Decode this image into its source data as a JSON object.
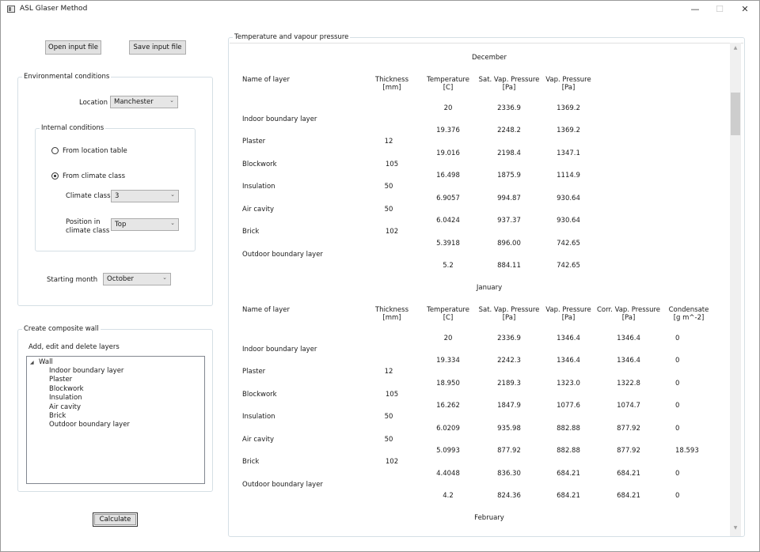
{
  "window": {
    "title": "ASL Glaser Method",
    "min": "—",
    "max": "☐",
    "close": "✕"
  },
  "buttons": {
    "open": "Open input file",
    "save": "Save input file",
    "calculate": "Calculate"
  },
  "env": {
    "title": "Environmental conditions",
    "location_label": "Location",
    "location_value": "Manchester",
    "internal": {
      "title": "Internal conditions",
      "radio_location": "From location table",
      "radio_climate": "From climate class",
      "climate_class_label": "Climate class",
      "climate_class_value": "3",
      "position_label_1": "Position in",
      "position_label_2": "climate class",
      "position_value": "Top"
    },
    "starting_month_label": "Starting month",
    "starting_month_value": "October"
  },
  "wall": {
    "title": "Create composite wall",
    "subtitle": "Add, edit and delete layers",
    "root": "Wall",
    "layers": [
      "Indoor boundary layer",
      "Plaster",
      "Blockwork",
      "Insulation",
      "Air cavity",
      "Brick",
      "Outdoor boundary layer"
    ]
  },
  "results": {
    "title": "Temperature and vapour pressure",
    "headers": {
      "name": "Name of layer",
      "thick1": "Thickness",
      "thick2": "[mm]",
      "temp1": "Temperature",
      "temp2": "[C]",
      "sat1": "Sat. Vap. Pressure",
      "sat2": "[Pa]",
      "vap1": "Vap. Pressure",
      "vap2": "[Pa]",
      "corr1": "Corr. Vap. Pressure",
      "corr2": "[Pa]",
      "cond1": "Condensate",
      "cond2": "[g m^-2]"
    },
    "december": {
      "month": "December",
      "layers": [
        {
          "name": "Indoor boundary layer",
          "thickness": ""
        },
        {
          "name": "Plaster",
          "thickness": "12"
        },
        {
          "name": "Blockwork",
          "thickness": "105"
        },
        {
          "name": "Insulation",
          "thickness": "50"
        },
        {
          "name": "Air cavity",
          "thickness": "50"
        },
        {
          "name": "Brick",
          "thickness": "102"
        },
        {
          "name": "Outdoor boundary layer",
          "thickness": ""
        }
      ],
      "interfaces": [
        {
          "temp": "20",
          "sat": "2336.9",
          "vap": "1369.2"
        },
        {
          "temp": "19.376",
          "sat": "2248.2",
          "vap": "1369.2"
        },
        {
          "temp": "19.016",
          "sat": "2198.4",
          "vap": "1347.1"
        },
        {
          "temp": "16.498",
          "sat": "1875.9",
          "vap": "1114.9"
        },
        {
          "temp": "6.9057",
          "sat": "994.87",
          "vap": "930.64"
        },
        {
          "temp": "6.0424",
          "sat": "937.37",
          "vap": "930.64"
        },
        {
          "temp": "5.3918",
          "sat": "896.00",
          "vap": "742.65"
        },
        {
          "temp": "5.2",
          "sat": "884.11",
          "vap": "742.65"
        }
      ]
    },
    "january": {
      "month": "January",
      "layers": [
        {
          "name": "Indoor boundary layer",
          "thickness": ""
        },
        {
          "name": "Plaster",
          "thickness": "12"
        },
        {
          "name": "Blockwork",
          "thickness": "105"
        },
        {
          "name": "Insulation",
          "thickness": "50"
        },
        {
          "name": "Air cavity",
          "thickness": "50"
        },
        {
          "name": "Brick",
          "thickness": "102"
        },
        {
          "name": "Outdoor boundary layer",
          "thickness": ""
        }
      ],
      "interfaces": [
        {
          "temp": "20",
          "sat": "2336.9",
          "vap": "1346.4",
          "corr": "1346.4",
          "cond": "0"
        },
        {
          "temp": "19.334",
          "sat": "2242.3",
          "vap": "1346.4",
          "corr": "1346.4",
          "cond": "0"
        },
        {
          "temp": "18.950",
          "sat": "2189.3",
          "vap": "1323.0",
          "corr": "1322.8",
          "cond": "0"
        },
        {
          "temp": "16.262",
          "sat": "1847.9",
          "vap": "1077.6",
          "corr": "1074.7",
          "cond": "0"
        },
        {
          "temp": "6.0209",
          "sat": "935.98",
          "vap": "882.88",
          "corr": "877.92",
          "cond": "0"
        },
        {
          "temp": "5.0993",
          "sat": "877.92",
          "vap": "882.88",
          "corr": "877.92",
          "cond": "18.593"
        },
        {
          "temp": "4.4048",
          "sat": "836.30",
          "vap": "684.21",
          "corr": "684.21",
          "cond": "0"
        },
        {
          "temp": "4.2",
          "sat": "824.36",
          "vap": "684.21",
          "corr": "684.21",
          "cond": "0"
        }
      ]
    },
    "february": {
      "month": "February"
    }
  },
  "icons": {
    "chevron": "⌄",
    "tree_expanded": "◢",
    "scroll_up": "▲",
    "scroll_down": "▼"
  }
}
